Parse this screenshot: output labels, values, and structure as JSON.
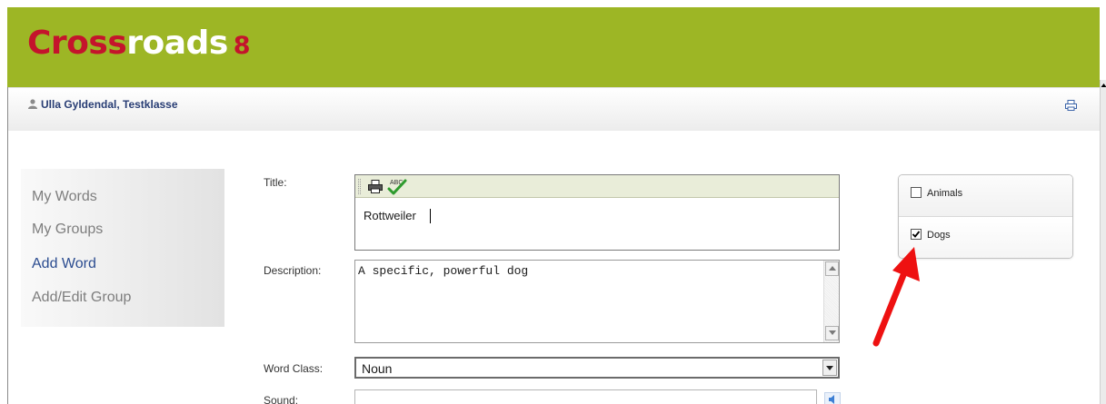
{
  "header": {
    "logo_part1": "Cross",
    "logo_part2": "roads",
    "logo_part3": "8",
    "background_color": "#9db625",
    "logo_accent_color": "#c4142c"
  },
  "userbar": {
    "user_icon": "user-icon",
    "user_name": "Ulla Gyldendal, Testklasse",
    "print_icon": "printer-icon"
  },
  "sidebar": {
    "items": [
      {
        "label": "My Words",
        "active": false
      },
      {
        "label": "My Groups",
        "active": false
      },
      {
        "label": "Add Word",
        "active": true
      },
      {
        "label": "Add/Edit Group",
        "active": false
      }
    ]
  },
  "form": {
    "title_label": "Title:",
    "title_value": "Rottweiler",
    "toolbar_icons": [
      "printer-icon",
      "spellcheck-icon"
    ],
    "description_label": "Description:",
    "description_value": "A specific, powerful dog",
    "word_class_label": "Word Class:",
    "word_class_value": "Noun",
    "sound_label": "Sound:",
    "sound_value": "",
    "sound_icon": "speaker-icon"
  },
  "groups": [
    {
      "label": "Animals",
      "checked": false
    },
    {
      "label": "Dogs",
      "checked": true
    }
  ],
  "annotation": {
    "icon": "red-arrow-icon",
    "color": "#ee1111"
  }
}
